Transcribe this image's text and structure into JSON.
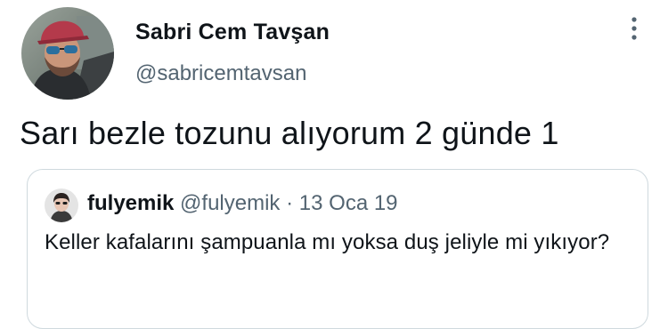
{
  "tweet": {
    "author_name": "Sabri Cem Tavşan",
    "author_handle": "@sabricemtavsan",
    "text": "Sarı bezle tozunu alıyorum 2 günde 1",
    "avatar_icon": "profile-photo",
    "more_icon": "more-vertical-icon"
  },
  "quoted_tweet": {
    "author_name": "fulyemik",
    "author_handle": "@fulyemik",
    "separator": "·",
    "date": "13 Oca 19",
    "text": "Keller kafalarını şampuanla mı yoksa duş jeliyle mi yıkıyor?",
    "avatar_icon": "profile-photo"
  },
  "colors": {
    "text_primary": "#0f1419",
    "text_secondary": "#536471",
    "border": "#cfd9de"
  }
}
